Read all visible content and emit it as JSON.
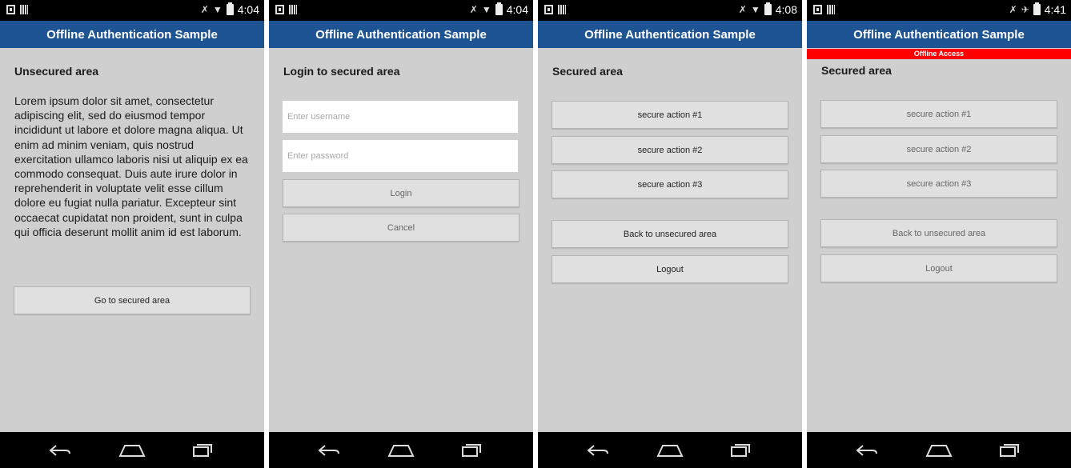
{
  "app_title": "Offline Authentication Sample",
  "screens": [
    {
      "status_time": "4:04",
      "heading": "Unsecured area",
      "body": "Lorem ipsum dolor sit amet, consectetur adipiscing elit, sed do eiusmod tempor incididunt ut labore et dolore magna aliqua. Ut enim ad minim veniam, quis nostrud exercitation ullamco laboris nisi ut aliquip ex ea commodo consequat. Duis aute irure dolor in reprehenderit in voluptate velit esse cillum dolore eu fugiat nulla pariatur. Excepteur sint occaecat cupidatat non proident, sunt in culpa qui officia deserunt mollit anim id est laborum.",
      "go_secured_label": "Go to secured area"
    },
    {
      "status_time": "4:04",
      "heading": "Login to secured area",
      "username_placeholder": "Enter username",
      "password_placeholder": "Enter password",
      "login_label": "Login",
      "cancel_label": "Cancel"
    },
    {
      "status_time": "4:08",
      "heading": "Secured area",
      "actions": [
        "secure action #1",
        "secure action #2",
        "secure action #3"
      ],
      "back_label": "Back to unsecured area",
      "logout_label": "Logout"
    },
    {
      "status_time": "4:41",
      "offline_banner": "Offline Access",
      "heading": "Secured area",
      "actions": [
        "secure action #1",
        "secure action #2",
        "secure action #3"
      ],
      "back_label": "Back to unsecured area",
      "logout_label": "Logout"
    }
  ],
  "icons": {
    "status_left": [
      "sim-icon",
      "signal-bars-icon"
    ],
    "status_right": [
      "no-vibrate-icon",
      "wifi-icon",
      "battery-icon"
    ],
    "status_right_airplane": [
      "no-vibrate-icon",
      "airplane-icon",
      "battery-icon"
    ],
    "nav": [
      "back-icon",
      "home-icon",
      "recent-apps-icon"
    ]
  },
  "colors": {
    "titlebar": "#1f5494",
    "offline_banner": "#ff0000",
    "background": "#cfcfcf"
  }
}
